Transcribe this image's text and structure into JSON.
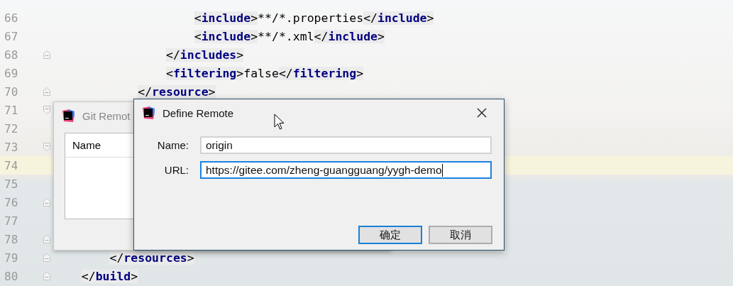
{
  "editor": {
    "lines": [
      {
        "number": "66",
        "code": "                    <include>**/*.properties</include>",
        "current": false,
        "fold_start": false,
        "fold_end": false
      },
      {
        "number": "67",
        "code": "                    <include>**/*.xml</include>",
        "current": false,
        "fold_start": false,
        "fold_end": false
      },
      {
        "number": "68",
        "code": "                </includes>",
        "current": false,
        "fold_start": false,
        "fold_end": true
      },
      {
        "number": "69",
        "code": "                <filtering>false</filtering>",
        "current": false,
        "fold_start": false,
        "fold_end": false
      },
      {
        "number": "70",
        "code": "            </resource>",
        "current": false,
        "fold_start": false,
        "fold_end": true
      },
      {
        "number": "71",
        "current": false,
        "fold_start": true,
        "fold_end": false
      },
      {
        "number": "72",
        "current": false,
        "fold_start": false,
        "fold_end": false
      },
      {
        "number": "73",
        "current": false,
        "fold_start": true,
        "fold_end": false
      },
      {
        "number": "74",
        "current": true,
        "fold_start": false,
        "fold_end": false
      },
      {
        "number": "75",
        "current": false,
        "fold_start": false,
        "fold_end": false
      },
      {
        "number": "76",
        "current": false,
        "fold_start": false,
        "fold_end": true
      },
      {
        "number": "77",
        "current": false,
        "fold_start": false,
        "fold_end": false
      },
      {
        "number": "78",
        "current": false,
        "fold_start": false,
        "fold_end": true
      },
      {
        "number": "79",
        "code": "        </resources>",
        "current": false,
        "fold_start": false,
        "fold_end": true
      },
      {
        "number": "80",
        "code": "    </build>",
        "current": false,
        "fold_start": false,
        "fold_end": true
      }
    ]
  },
  "git_remotes_window": {
    "title": "Git Remot",
    "table": {
      "columns": [
        "Name"
      ]
    }
  },
  "define_remote_dialog": {
    "title": "Define Remote",
    "fields": [
      {
        "label": "Name:",
        "value": "origin",
        "focused": false
      },
      {
        "label": "URL:",
        "value": "https://gitee.com/zheng-guangguang/yygh-demo",
        "focused": true
      }
    ],
    "buttons": [
      {
        "label": "确定",
        "default": true
      },
      {
        "label": "取消",
        "default": false
      }
    ]
  }
}
